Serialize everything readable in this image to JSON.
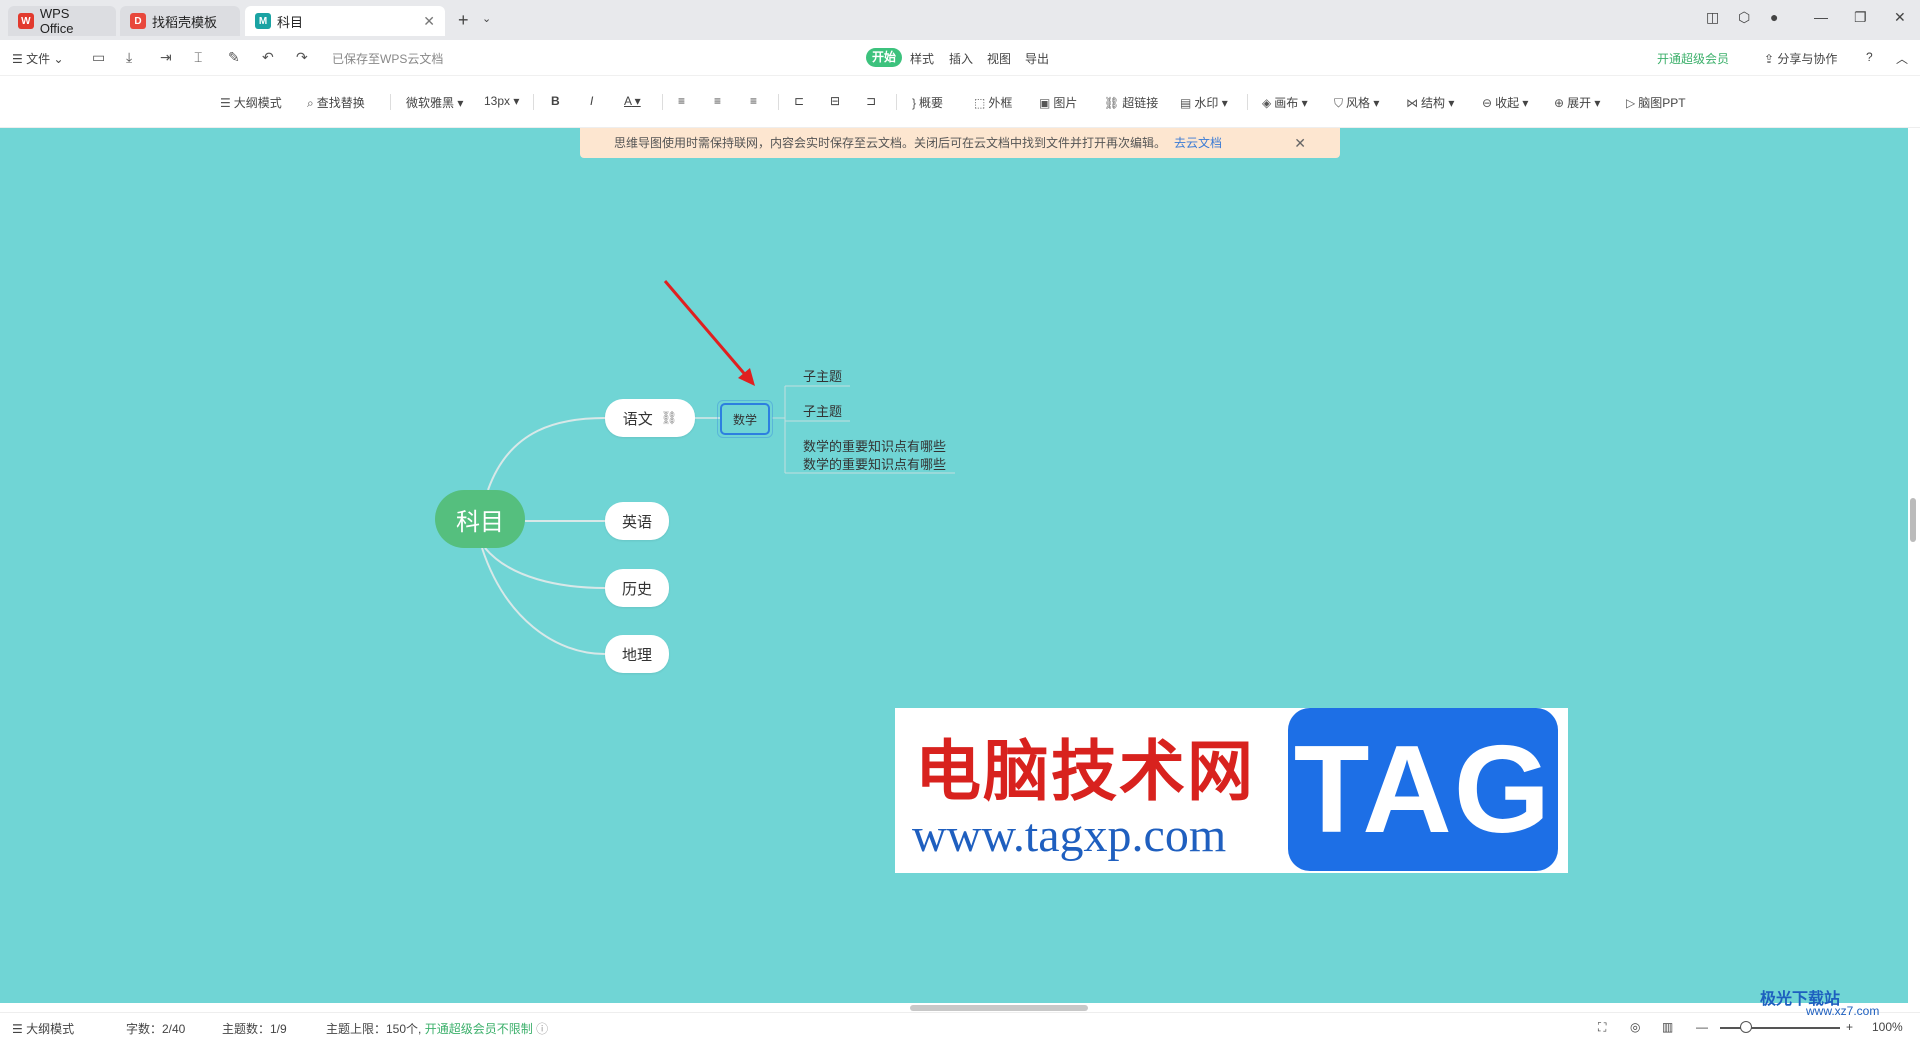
{
  "tabs": {
    "wps": "WPS Office",
    "template": "找稻壳模板",
    "doc": "科目"
  },
  "menubar": {
    "file": "文件",
    "saved_status": "已保存至WPS云文档",
    "start": "开始",
    "style": "样式",
    "insert": "插入",
    "view": "视图",
    "export": "导出",
    "vip": "开通超级会员",
    "share": "分享与协作",
    "help": "?"
  },
  "toolbar": {
    "outline_mode": "大纲模式",
    "find_replace": "查找替换",
    "font": "微软雅黑",
    "font_size": "13px",
    "bold": "B",
    "italic": "I",
    "font_color": "A",
    "summary": "概要",
    "frame": "外框",
    "image": "图片",
    "hyperlink": "超链接",
    "watermark": "水印",
    "canvas": "画布",
    "theme_style": "风格",
    "structure": "结构",
    "collapse": "收起",
    "expand": "展开",
    "to_ppt": "脑图PPT"
  },
  "notice": {
    "text": "思维导图使用时需保持联网，内容会实时保存至云文档。关闭后可在云文档中找到文件并打开再次编辑。",
    "link": "去云文档"
  },
  "mindmap": {
    "root": "科目",
    "branches": [
      "语文",
      "英语",
      "历史",
      "地理"
    ],
    "selected": "数学",
    "subtopics": [
      "子主题",
      "子主题",
      "数学的重要知识点有哪些",
      "数学的重要知识点有哪些"
    ]
  },
  "watermark": {
    "cn": "电脑技术网",
    "url": "www.tagxp.com",
    "tag": "TAG",
    "corner": "极光下载站",
    "corner_url": "www.xz7.com"
  },
  "statusbar": {
    "outline_mode": "大纲模式",
    "word_count": "字数：2/40",
    "topic_count": "主题数：1/9",
    "topic_limit": "主题上限：150个,",
    "vip_unlimited": "开通超级会员不限制",
    "zoom": "100%"
  },
  "colors": {
    "canvas": "#70d5d5",
    "root_node": "#55bf7e",
    "selection": "#2d7fe0",
    "accent_green": "#3cc27d"
  }
}
